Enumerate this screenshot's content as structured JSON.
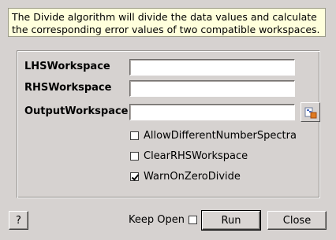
{
  "description": "The Divide algorithm will divide the data values and calculate\nthe corresponding error values of two compatible workspaces.",
  "properties": [
    {
      "label": "LHSWorkspace",
      "value": ""
    },
    {
      "label": "RHSWorkspace",
      "value": ""
    },
    {
      "label": "OutputWorkspace",
      "value": ""
    }
  ],
  "options": [
    {
      "label": "AllowDifferentNumberSpectra",
      "checked": false
    },
    {
      "label": "ClearRHSWorkspace",
      "checked": false
    },
    {
      "label": "WarnOnZeroDivide",
      "checked": true
    }
  ],
  "footer": {
    "help_label": "?",
    "keep_open_label": "Keep Open",
    "keep_open_checked": false,
    "run_label": "Run",
    "close_label": "Close"
  },
  "icons": {
    "browse": "folder-browse-icon"
  }
}
